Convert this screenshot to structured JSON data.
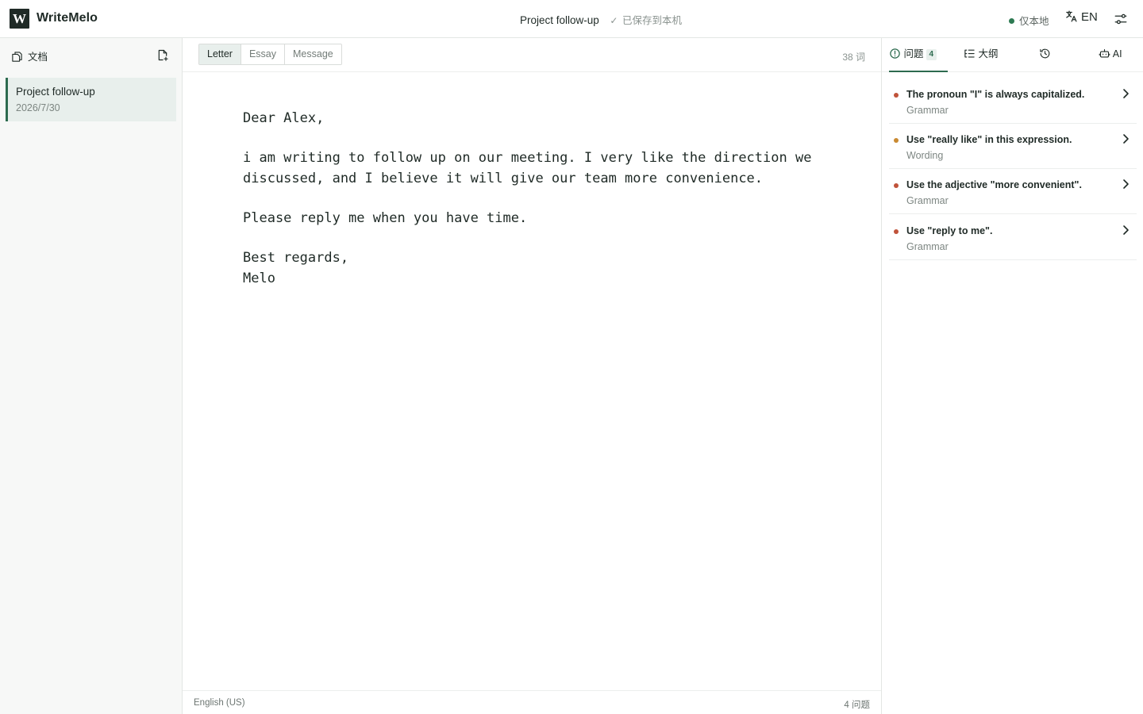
{
  "app": {
    "logo_letter": "W",
    "name": "WriteMelo"
  },
  "header": {
    "document_title": "Project follow-up",
    "save_status": "已保存到本机",
    "local_only": "仅本地",
    "language_label": "EN"
  },
  "sidebar": {
    "title": "文档",
    "documents": [
      {
        "title": "Project follow-up",
        "date": "2026/7/30"
      }
    ]
  },
  "editor": {
    "tabs": [
      {
        "label": "Letter",
        "active": true
      },
      {
        "label": "Essay",
        "active": false
      },
      {
        "label": "Message",
        "active": false
      }
    ],
    "word_count": "38 词",
    "content": {
      "greeting": "Dear Alex,",
      "para1": "i am writing to follow up on our meeting. I very like the direction we discussed, and I believe it will give our team more convenience.",
      "para2": "Please reply me when you have time.",
      "closing": "Best regards,",
      "signature": "Melo"
    },
    "status_language": "English (US)",
    "status_issues": "4 问题"
  },
  "panel": {
    "tabs": {
      "issues": "问题",
      "issues_count": "4",
      "outline": "大纲",
      "ai": "AI"
    },
    "issues": [
      {
        "title": "The pronoun \"I\" is always capitalized.",
        "category": "Grammar",
        "color": "#c0533a"
      },
      {
        "title": "Use \"really like\" in this expression.",
        "category": "Wording",
        "color": "#c98a32"
      },
      {
        "title": "Use the adjective \"more convenient\".",
        "category": "Grammar",
        "color": "#c0533a"
      },
      {
        "title": "Use \"reply to me\".",
        "category": "Grammar",
        "color": "#c0533a"
      }
    ]
  },
  "colors": {
    "accent": "#2d6b4f",
    "accent_light": "#e8efec",
    "grammar": "#c0533a",
    "wording": "#c98a32",
    "local_dot": "#2d7a52"
  }
}
